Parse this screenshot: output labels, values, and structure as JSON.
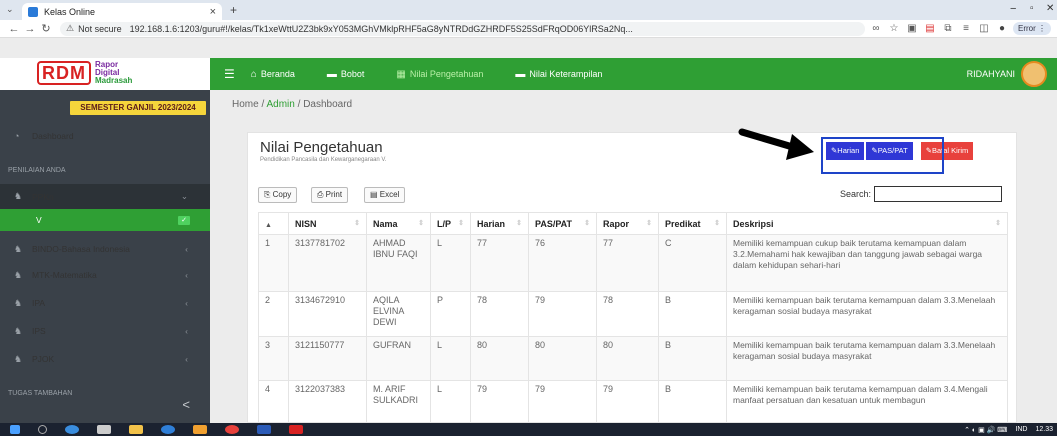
{
  "browser": {
    "tab_title": "Kelas Online",
    "tab_close": "×",
    "new_tab": "+",
    "not_secure": "Not secure",
    "url": "192.168.1.6:1203/guru#!/kelas/Tk1xeWttU2Z3bk9xY053MGhVMklpRHF5aG8yNTRDdGZHRDF5S25SdFRqOD06YlRSa2Nq...",
    "error_label": "Error",
    "window_min": "−",
    "window_max": "▫",
    "window_close": "✕"
  },
  "brand": {
    "mark": "RDM",
    "line1": "Rapor",
    "line2": "Digital",
    "line3": "Madrasah"
  },
  "topnav": {
    "items": [
      {
        "label": "Beranda",
        "icon": "home-icon"
      },
      {
        "label": "Bobot",
        "icon": "weight-icon"
      },
      {
        "label": "Nilai Pengetahuan",
        "icon": "chart-icon"
      },
      {
        "label": "Nilai Keterampilan",
        "icon": "chart-icon"
      }
    ],
    "user": "RIDAHYANI"
  },
  "sidebar": {
    "semester": "SEMESTER GANJIL 2023/2024",
    "dashboard": "Dashboard",
    "section1": "PENILAIAN ANDA",
    "items": [
      {
        "label": "PPKn"
      },
      {
        "label": "V"
      },
      {
        "label": "BINDO-Bahasa Indonesia"
      },
      {
        "label": "MTK-Matematika"
      },
      {
        "label": "IPA"
      },
      {
        "label": "IPS"
      },
      {
        "label": "PJOK"
      }
    ],
    "section2": "TUGAS TAMBAHAN",
    "collapse": "<"
  },
  "breadcrumb": {
    "home": "Home",
    "admin": "Admin",
    "current": "Dashboard",
    "sep": "/"
  },
  "card": {
    "title": "Nilai Pengetahuan",
    "subtitle": "Pendidikan Pancasila dan Kewarganegaraan V.",
    "btn_harian": "Harian",
    "btn_pas": "PAS/PAT",
    "btn_batal": "Batal Kirim",
    "btn_copy": "Copy",
    "btn_print": "Print",
    "btn_excel": "Excel",
    "search_label": "Search:",
    "search_value": ""
  },
  "colors": {
    "green": "#2f9f34",
    "blue_btn": "#2f37d6",
    "red_btn": "#e8413c",
    "highlight": "#1e44c8",
    "sidebar": "#3a4149",
    "semester": "#f5d53b"
  },
  "table": {
    "headers": [
      "",
      "NISN",
      "Nama",
      "L/P",
      "Harian",
      "PAS/PAT",
      "Rapor",
      "Predikat",
      "Deskripsi"
    ],
    "rows": [
      {
        "no": "1",
        "nisn": "3137781702",
        "nama": "AHMAD IBNU FAQI",
        "lp": "L",
        "harian": "77",
        "pas": "76",
        "rapor": "77",
        "predikat": "C",
        "desc": "Memiliki kemampuan cukup baik terutama kemampuan dalam 3.2.Memahami hak kewajiban dan tanggung jawab sebagai warga dalam kehidupan sehari-hari"
      },
      {
        "no": "2",
        "nisn": "3134672910",
        "nama": "AQILA ELVINA DEWI",
        "lp": "P",
        "harian": "78",
        "pas": "79",
        "rapor": "78",
        "predikat": "B",
        "desc": "Memiliki kemampuan baik terutama kemampuan dalam 3.3.Menelaah keragaman sosial budaya masyrakat"
      },
      {
        "no": "3",
        "nisn": "3121150777",
        "nama": "GUFRAN",
        "lp": "L",
        "harian": "80",
        "pas": "80",
        "rapor": "80",
        "predikat": "B",
        "desc": "Memiliki kemampuan baik terutama kemampuan dalam 3.3.Menelaah keragaman sosial budaya masyrakat"
      },
      {
        "no": "4",
        "nisn": "3122037383",
        "nama": "M. ARIF SULKADRI",
        "lp": "L",
        "harian": "79",
        "pas": "79",
        "rapor": "79",
        "predikat": "B",
        "desc": "Memiliki kemampuan baik terutama kemampuan dalam 3.4.Mengali manfaat persatuan dan kesatuan untuk membagun"
      }
    ]
  },
  "taskbar": {
    "lang": "IND",
    "time": "12.33"
  }
}
